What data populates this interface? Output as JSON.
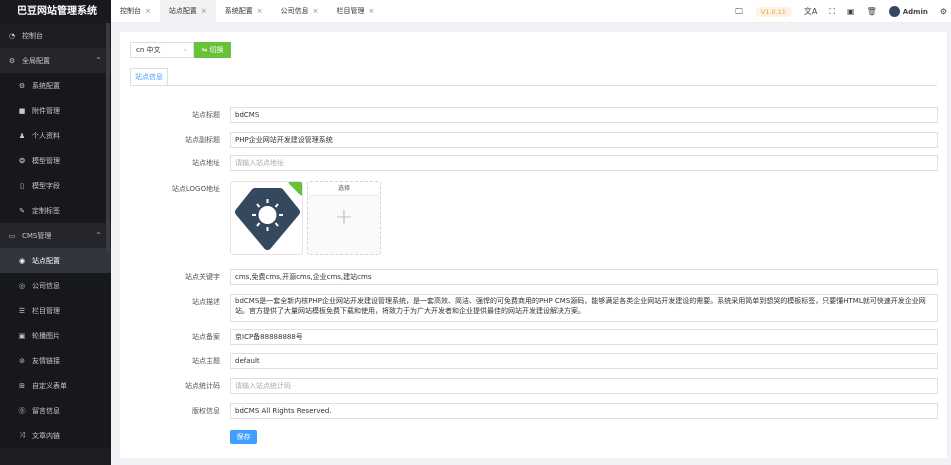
{
  "app": {
    "title": "巴豆网站管理系统"
  },
  "sidebar": {
    "items": [
      {
        "label": "控制台",
        "icon": "dashboard-icon",
        "glyph": "◔",
        "type": "top"
      },
      {
        "label": "全局配置",
        "icon": "settings-group-icon",
        "glyph": "⚙",
        "type": "grp",
        "chev": "^"
      },
      {
        "label": "系统配置",
        "icon": "gear-icon",
        "glyph": "⚙",
        "type": "sub"
      },
      {
        "label": "附件管理",
        "icon": "folder-icon",
        "glyph": "■",
        "type": "sub"
      },
      {
        "label": "个人资料",
        "icon": "user-icon",
        "glyph": "♟",
        "type": "sub"
      },
      {
        "label": "模型管理",
        "icon": "model-icon",
        "glyph": "❂",
        "type": "sub"
      },
      {
        "label": "模型字段",
        "icon": "field-icon",
        "glyph": "▯",
        "type": "sub"
      },
      {
        "label": "定制标签",
        "icon": "wrench-icon",
        "glyph": "✎",
        "type": "sub"
      },
      {
        "label": "CMS管理",
        "icon": "monitor-icon",
        "glyph": "▭",
        "type": "grp",
        "chev": "^"
      },
      {
        "label": "站点配置",
        "icon": "site-icon",
        "glyph": "◉",
        "type": "sub active"
      },
      {
        "label": "公司信息",
        "icon": "company-icon",
        "glyph": "◎",
        "type": "sub"
      },
      {
        "label": "栏目管理",
        "icon": "list-icon",
        "glyph": "☰",
        "type": "sub"
      },
      {
        "label": "轮播图片",
        "icon": "image-icon",
        "glyph": "▣",
        "type": "sub"
      },
      {
        "label": "友情链接",
        "icon": "link-icon",
        "glyph": "⊘",
        "type": "sub"
      },
      {
        "label": "自定义表单",
        "icon": "form-icon",
        "glyph": "⊞",
        "type": "sub"
      },
      {
        "label": "留言信息",
        "icon": "message-icon",
        "glyph": "⓪",
        "type": "sub"
      },
      {
        "label": "文章内链",
        "icon": "shuffle-icon",
        "glyph": "⤨",
        "type": "sub"
      }
    ]
  },
  "tabs": [
    {
      "label": "控制台"
    },
    {
      "label": "站点配置",
      "active": true
    },
    {
      "label": "系统配置"
    },
    {
      "label": "公司信息"
    },
    {
      "label": "栏目管理"
    }
  ],
  "tools": {
    "version": "V1.0.11",
    "user": "Admin"
  },
  "lang": {
    "selected": "cn 中文",
    "switch": "切换"
  },
  "content_tab": "站点信息",
  "form": {
    "title": {
      "label": "站点标题",
      "value": "bdCMS"
    },
    "subtitle": {
      "label": "站点副标题",
      "value": "PHP企业网站开发建设管理系统"
    },
    "url": {
      "label": "站点地址",
      "placeholder": "请输入站点地址"
    },
    "logo": {
      "label": "站点LOGO地址",
      "pick": "选择",
      "plus": "+"
    },
    "keywords": {
      "label": "站点关键字",
      "value": "cms,免费cms,开源cms,企业cms,建站cms"
    },
    "desc": {
      "label": "站点描述",
      "value": "bdCMS是一套全新内核PHP企业网站开发建设管理系统，是一套高效、简洁、强悍的可免费商用的PHP CMS源码，能够满足各类企业网站开发建设的需要。系统采用简单到想哭的模板标签，只要懂HTML就可快速开发企业网站。官方提供了大量网站模板免费下载和使用，将致力于为广大开发者和企业提供最佳的网站开发建设解决方案。"
    },
    "icp": {
      "label": "站点备案",
      "value": "京ICP备88888888号"
    },
    "theme": {
      "label": "站点主题",
      "value": "default"
    },
    "stats": {
      "label": "站点统计码",
      "placeholder": "请输入站点统计码"
    },
    "copyright": {
      "label": "版权信息",
      "value": "bdCMS All Rights Reserved."
    },
    "save": "保存"
  },
  "colors": {
    "primary": "#409eff",
    "success": "#67c23a",
    "sidebar": "#1d1e23",
    "logo": "#34495e"
  }
}
